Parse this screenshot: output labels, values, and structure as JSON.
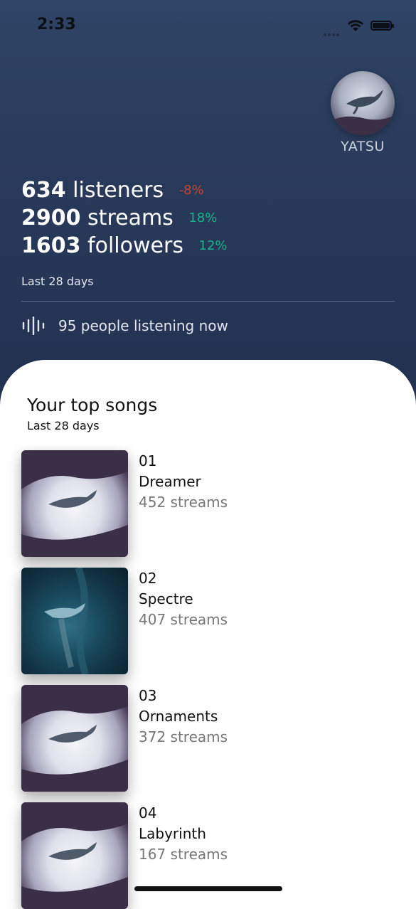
{
  "status_bar": {
    "time": "2:33"
  },
  "artist": {
    "name": "YATSU"
  },
  "stats": [
    {
      "value": "634",
      "label": "listeners",
      "change": "-8%",
      "trend": "negative"
    },
    {
      "value": "2900",
      "label": "streams",
      "change": "18%",
      "trend": "positive"
    },
    {
      "value": "1603",
      "label": "followers",
      "change": "12%",
      "trend": "positive"
    }
  ],
  "period_label": "Last 28 days",
  "live": {
    "text": "95 people listening now",
    "icon": "audio-wave-icon"
  },
  "top_songs": {
    "title": "Your top songs",
    "subtitle": "Last 28 days",
    "songs": [
      {
        "rank": "01",
        "title": "Dreamer",
        "streams": "452 streams",
        "cover": "whale-clouds-art"
      },
      {
        "rank": "02",
        "title": "Spectre",
        "streams": "407 streams",
        "cover": "whale-underwater-art"
      },
      {
        "rank": "03",
        "title": "Ornaments",
        "streams": "372 streams",
        "cover": "whale-clouds-art"
      },
      {
        "rank": "04",
        "title": "Labyrinth",
        "streams": "167 streams",
        "cover": "whale-clouds-art"
      }
    ]
  },
  "colors": {
    "negative": "#c0452c",
    "positive": "#19b38a",
    "hero_bg": "#2b3c5e"
  }
}
